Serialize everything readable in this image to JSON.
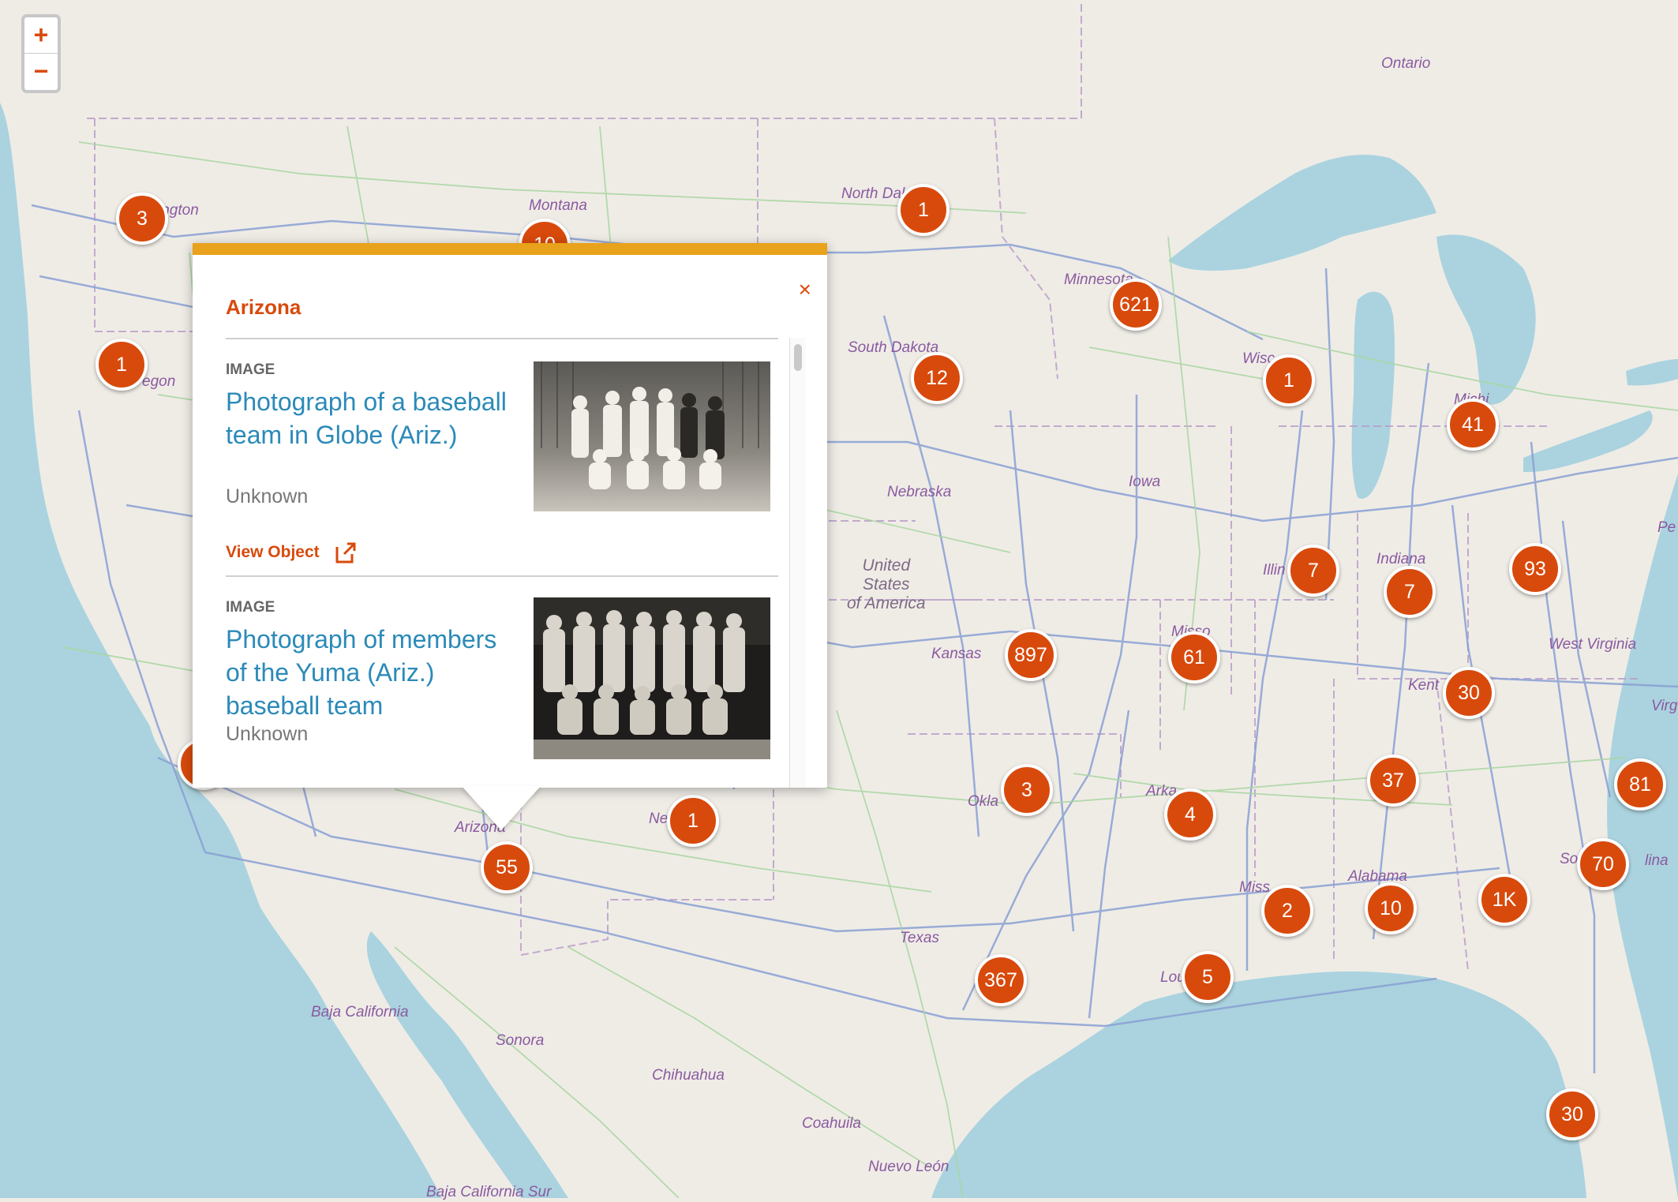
{
  "zoom": {
    "in_label": "+",
    "out_label": "−"
  },
  "labels": {
    "ontario": "Ontario",
    "washington": "ington",
    "montana": "Montana",
    "north_dakota": "North Dak",
    "minnesota": "Minnesota",
    "south_dakota": "South Dakota",
    "oregon": "egon",
    "wisconsin": "Wisc",
    "michigan": "Michi",
    "nebraska": "Nebraska",
    "iowa": "Iowa",
    "usa": [
      "United",
      "States",
      "of America"
    ],
    "illinois": "Illin",
    "indiana": "Indiana",
    "kansas": "Kansas",
    "missouri": "Misso",
    "west_virginia": "West Virginia",
    "pe": "Pe",
    "kentucky": "Kent",
    "virg": "Virg",
    "oklahoma": "Okla",
    "arkansas": "Arka",
    "arizona": "Arizona",
    "new_mexico": "Ne",
    "mississippi": "Miss",
    "alabama": "Alabama",
    "sc": "So",
    "lina": "lina",
    "texas": "Texas",
    "louisiana": "Lou",
    "baja_california": "Baja California",
    "sonora": "Sonora",
    "chihuahua": "Chihuahua",
    "coahuila": "Coahuila",
    "nuevo_leon": "Nuevo León",
    "baja_california_sur": "Baja California Sur"
  },
  "markers": [
    "3",
    "10",
    "1",
    "621",
    "1",
    "12",
    "1",
    "41",
    "7",
    "7",
    "93",
    "897",
    "61",
    "30",
    "3",
    "4",
    "37",
    "81",
    "1",
    "55",
    "70",
    "2",
    "10",
    "1K",
    "367",
    "5",
    "30"
  ],
  "popup": {
    "title": "Arizona",
    "close_label": "×",
    "items": [
      {
        "type": "IMAGE",
        "title": "Photograph of a baseball team in Globe (Ariz.)",
        "creator": "Unknown",
        "link_label": "View Object"
      },
      {
        "type": "IMAGE",
        "title": "Photograph of members of the Yuma (Ariz.) baseball team",
        "creator": "Unknown"
      }
    ]
  },
  "colors": {
    "land": "#efece6",
    "water": "#aad3df",
    "marker": "#d84a0c",
    "accent_bar": "#e8a21b",
    "link": "#2b8ab8",
    "highway": "#8aa0d4",
    "road": "#a8d6a0",
    "border": "#b89ac8"
  }
}
